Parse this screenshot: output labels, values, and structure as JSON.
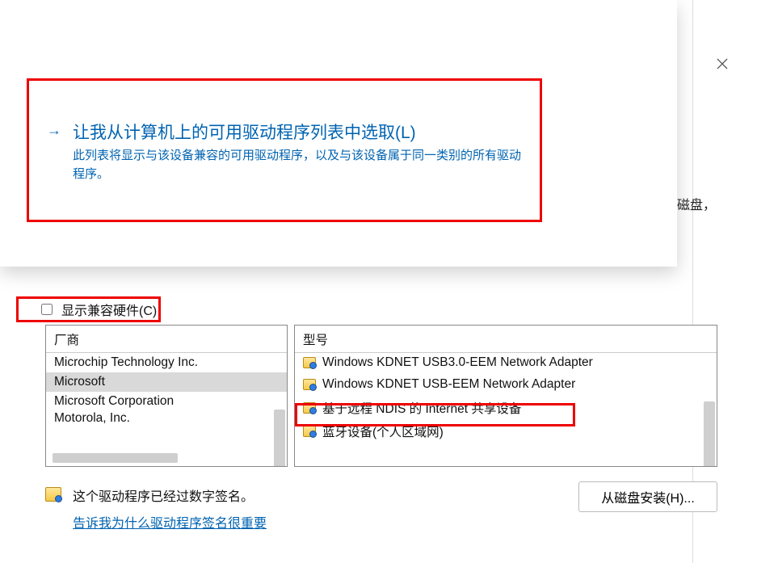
{
  "option": {
    "title": "让我从计算机上的可用驱动程序列表中选取(L)",
    "description": "此列表将显示与该设备兼容的可用驱动程序，以及与该设备属于同一类别的所有驱动程序。"
  },
  "background_text_fragment": "磁盘，",
  "compat_checkbox_label": "显示兼容硬件(C)",
  "manufacturer": {
    "header": "厂商",
    "items": [
      {
        "label": "Microchip Technology Inc.",
        "selected": false
      },
      {
        "label": "Microsoft",
        "selected": true
      },
      {
        "label": "Microsoft Corporation",
        "selected": false
      },
      {
        "label": "Motorola, Inc.",
        "selected": false
      }
    ]
  },
  "model": {
    "header": "型号",
    "items": [
      {
        "label": "Windows KDNET USB3.0-EEM Network Adapter"
      },
      {
        "label": "Windows KDNET USB-EEM Network Adapter"
      },
      {
        "label": "基于远程 NDIS 的 Internet 共享设备"
      },
      {
        "label": "蓝牙设备(个人区域网)"
      }
    ]
  },
  "signed": {
    "message": "这个驱动程序已经过数字签名。",
    "link": "告诉我为什么驱动程序签名很重要"
  },
  "disk_button": "从磁盘安装(H)..."
}
